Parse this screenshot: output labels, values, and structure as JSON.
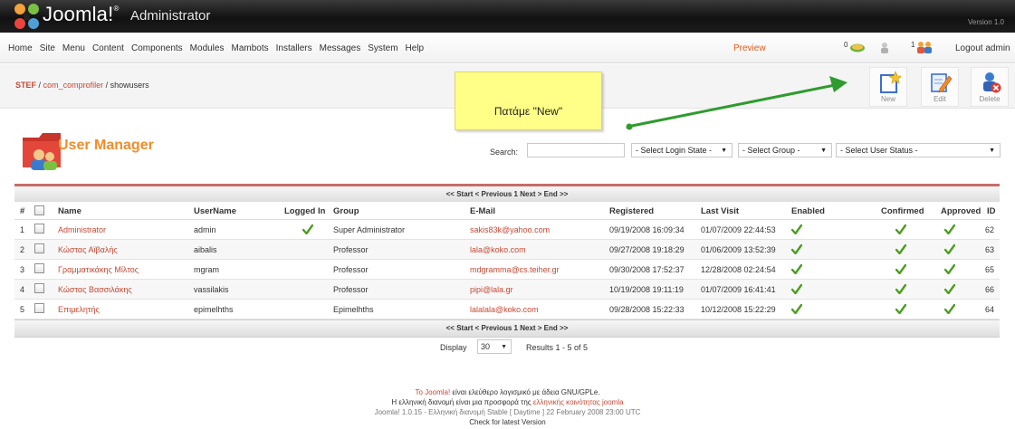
{
  "app": {
    "logo_text": "Joomla!",
    "logo_sup": "®",
    "admin_label": "Administrator",
    "version_label": "Version 1.0"
  },
  "menu": {
    "items": [
      "Home",
      "Site",
      "Menu",
      "Content",
      "Components",
      "Modules",
      "Mambots",
      "Installers",
      "Messages",
      "System",
      "Help"
    ],
    "preview": "Preview",
    "messages_count": "0",
    "users_online_count": "1",
    "logout": "Logout admin"
  },
  "breadcrumb": {
    "root": "STEF",
    "component": "com_comprofiler",
    "page": "showusers",
    "separator": "/"
  },
  "annotation": {
    "text": "Πατάμε \"New\"",
    "note_color": "#ffff88",
    "arrow_color": "#2e9b2e"
  },
  "toolbar": {
    "new_label": "New",
    "edit_label": "Edit",
    "delete_label": "Delete"
  },
  "page": {
    "title": "User Manager",
    "title_color": "#f28c28"
  },
  "filters": {
    "search_label": "Search:",
    "search_value": "",
    "login_state": "- Select Login State -",
    "group": "- Select Group -",
    "user_status": "- Select User Status -"
  },
  "pagination": {
    "text": "<< Start < Previous 1 Next > End >>",
    "display_label": "Display",
    "display_value": "30",
    "results_text": "Results 1 - 5 of 5"
  },
  "table": {
    "columns": {
      "num": "#",
      "name": "Name",
      "username": "UserName",
      "logged_in": "Logged In",
      "group": "Group",
      "email": "E-Mail",
      "registered": "Registered",
      "last_visit": "Last Visit",
      "enabled": "Enabled",
      "confirmed": "Confirmed",
      "approved": "Approved",
      "id": "ID"
    },
    "rows": [
      {
        "num": "1",
        "name": "Administrator",
        "username": "admin",
        "logged_in": true,
        "group": "Super Administrator",
        "email": "sakis83k@yahoo.com",
        "registered": "09/19/2008 16:09:34",
        "last_visit": "01/07/2009 22:44:53",
        "enabled": true,
        "confirmed": true,
        "approved": true,
        "id": "62"
      },
      {
        "num": "2",
        "name": "Κώστας Αϊβαλής",
        "username": "aibalis",
        "logged_in": false,
        "group": "Professor",
        "email": "lala@koko.com",
        "registered": "09/27/2008 19:18:29",
        "last_visit": "01/06/2009 13:52:39",
        "enabled": true,
        "confirmed": true,
        "approved": true,
        "id": "63"
      },
      {
        "num": "3",
        "name": "Γραμματικάκης Μίλτος",
        "username": "mgram",
        "logged_in": false,
        "group": "Professor",
        "email": "mdgramma@cs.teiher.gr",
        "registered": "09/30/2008 17:52:37",
        "last_visit": "12/28/2008 02:24:54",
        "enabled": true,
        "confirmed": true,
        "approved": true,
        "id": "65"
      },
      {
        "num": "4",
        "name": "Κώστας Βασσιλάκης",
        "username": "vassilakis",
        "logged_in": false,
        "group": "Professor",
        "email": "pipi@lala.gr",
        "registered": "10/19/2008 19:11:19",
        "last_visit": "01/07/2009 16:41:41",
        "enabled": true,
        "confirmed": true,
        "approved": true,
        "id": "66"
      },
      {
        "num": "5",
        "name": "Επιμελητής",
        "username": "epimelhths",
        "logged_in": false,
        "group": "Epimelhths",
        "email": "lalalala@koko.com",
        "registered": "09/28/2008 15:22:33",
        "last_visit": "10/12/2008 15:22:29",
        "enabled": true,
        "confirmed": true,
        "approved": true,
        "id": "64"
      }
    ]
  },
  "footer": {
    "line1_link": "Το Joomla!",
    "line1_rest": "είναι ελεύθερο λογισμικό με άδεια GNU/GPLe.",
    "line2_start": "Η ελληνική διανομή είναι μια προσφορά της",
    "line2_link": "ελληνικής κοινότητας joomla",
    "line3": "Joomla! 1.0.15 - Ελληνική διανομή Stable [ Daytime ] 22 February 2008 23:00 UTC",
    "line4": "Check for latest Version"
  },
  "colors": {
    "link": "#c64934",
    "check": "#4a9e1f",
    "table_accent": "#c76c6c"
  }
}
